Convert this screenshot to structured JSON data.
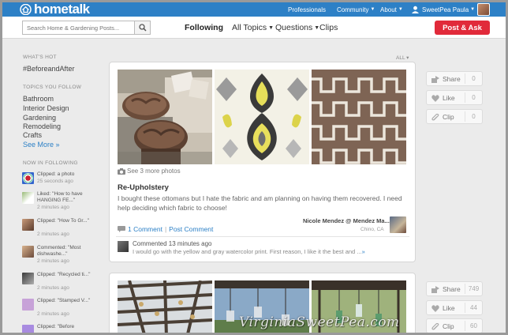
{
  "header": {
    "logo_text": "hometalk",
    "nav": {
      "professionals": "Professionals",
      "community": "Community",
      "about": "About",
      "user": "SweetPea Paula"
    },
    "brand_color": "#2d80c6"
  },
  "navbar": {
    "search_placeholder": "Search Home & Gardening Posts...",
    "following": "Following",
    "all_topics": "All Topics",
    "questions": "Questions",
    "clips": "Clips",
    "post_ask": "Post & Ask",
    "post_ask_color": "#e12a3a"
  },
  "sidebar": {
    "whats_hot_heading": "WHAT'S HOT",
    "hot_tag": "#BeforeandAfter",
    "topics_heading": "TOPICS YOU FOLLOW",
    "topics": [
      "Bathroom",
      "Interior Design",
      "Gardening",
      "Remodeling",
      "Crafts"
    ],
    "see_more": "See More »",
    "now_following_heading": "NOW IN FOLLOWING",
    "feed": [
      {
        "line1": "Clipped: a photo",
        "line2": "25 seconds ago"
      },
      {
        "line1": "Liked: \"How to have HANGING FE...\"",
        "line2": "2 minutes ago"
      },
      {
        "line1": "Clipped: \"How To Gr...\"",
        "line2": "2 minutes ago"
      },
      {
        "line1": "Commented: \"Most dishwashe...\"",
        "line2": "2 minutes ago"
      },
      {
        "line1": "Clipped: \"Recycled ti...\"",
        "line2": "2 minutes ago"
      },
      {
        "line1": "Clipped: \"Stamped V...\"",
        "line2": "2 minutes ago"
      },
      {
        "line1": "Clipped: \"Before"
      }
    ]
  },
  "feed_filter": "ALL",
  "post1": {
    "see_more_photos": "See 3 more photos",
    "title": "Re-Upholstery",
    "description": "I bought these ottomans but I hate the fabric and am planning on having them recovered. I need help deciding which fabric to choose!",
    "author": "Nicole Mendez @ Mendez Ma...",
    "location": "Chino, CA",
    "comment_count_link": "1 Comment",
    "post_comment_link": "Post Comment",
    "latest_comment_time": "Commented 13 minutes ago",
    "latest_comment_text": "I would go with the yellow and gray watercolor print. First reason, I like it the best and ...",
    "more_link": "»",
    "actions": {
      "share": {
        "label": "Share",
        "count": "0"
      },
      "like": {
        "label": "Like",
        "count": "0"
      },
      "clip": {
        "label": "Clip",
        "count": "0"
      }
    }
  },
  "post2": {
    "actions": {
      "share": {
        "label": "Share",
        "count": "749"
      },
      "like": {
        "label": "Like",
        "count": "44"
      },
      "clip": {
        "label": "Clip",
        "count": "60"
      }
    }
  },
  "watermark": "VirginiaSweetPea.com"
}
